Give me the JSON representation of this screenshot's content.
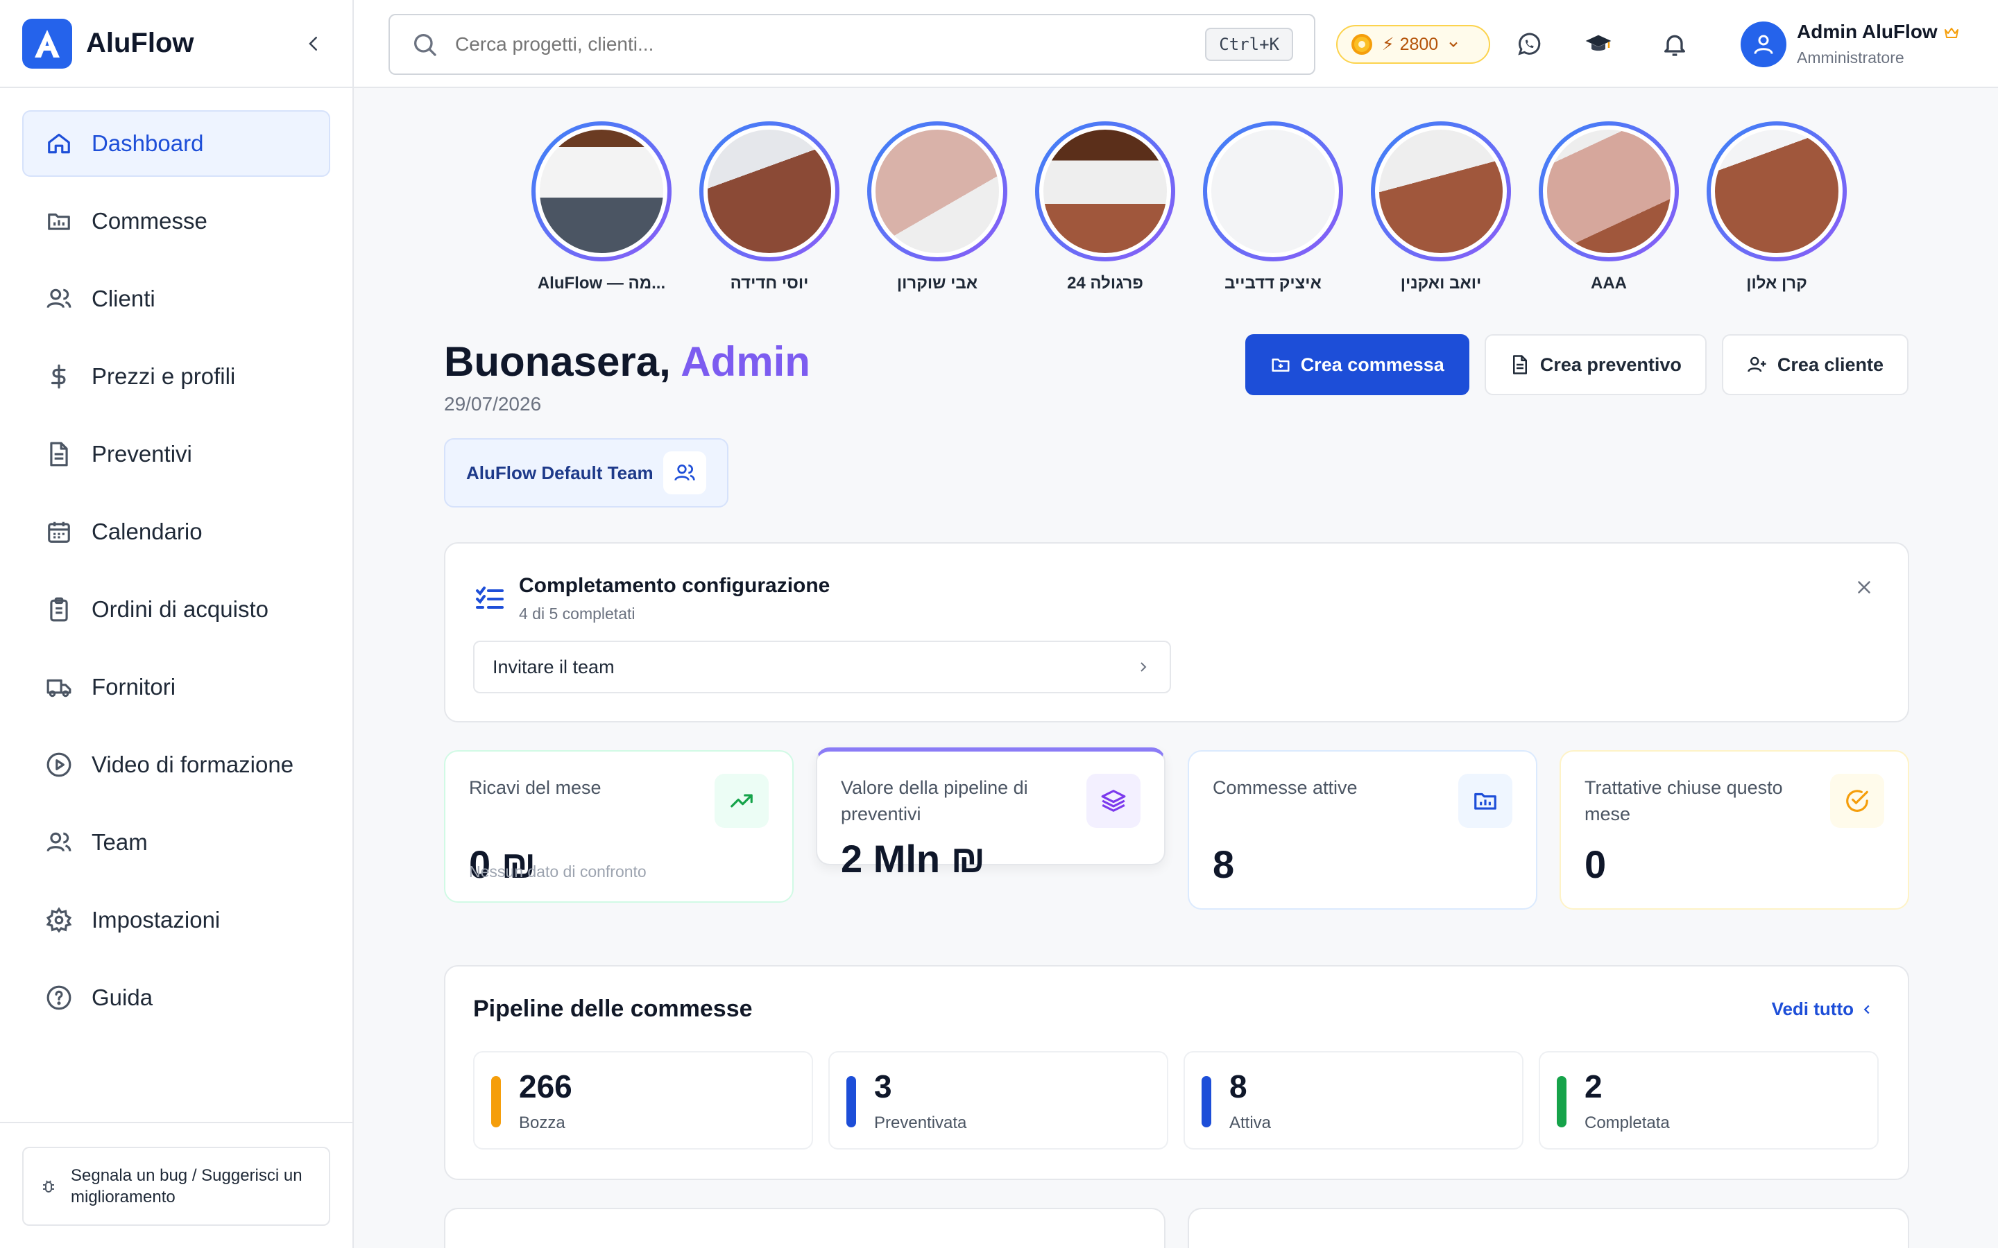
{
  "app": {
    "name": "AluFlow"
  },
  "sidebar": {
    "items": [
      {
        "label": "Dashboard",
        "icon": "home-icon",
        "active": true
      },
      {
        "label": "Commesse",
        "icon": "folder-icon"
      },
      {
        "label": "Clienti",
        "icon": "users-icon"
      },
      {
        "label": "Prezzi e profili",
        "icon": "dollar-icon"
      },
      {
        "label": "Preventivi",
        "icon": "file-text-icon"
      },
      {
        "label": "Calendario",
        "icon": "calendar-icon"
      },
      {
        "label": "Ordini di acquisto",
        "icon": "clipboard-icon"
      },
      {
        "label": "Fornitori",
        "icon": "truck-icon"
      },
      {
        "label": "Video di formazione",
        "icon": "play-circle-icon"
      },
      {
        "label": "Team",
        "icon": "team-icon"
      },
      {
        "label": "Impostazioni",
        "icon": "gear-icon"
      },
      {
        "label": "Guida",
        "icon": "help-circle-icon"
      }
    ],
    "bug_report": "Segnala un bug / Suggerisci un miglioramento"
  },
  "topbar": {
    "search_placeholder": "Cerca progetti, clienti...",
    "shortcut": "Ctrl+K",
    "credits": "2800",
    "user_name": "Admin AluFlow",
    "user_role": "Amministratore"
  },
  "stories": [
    {
      "label": "AluFlow — מה..."
    },
    {
      "label": "יוסי חדידה"
    },
    {
      "label": "אבי שוקרון"
    },
    {
      "label": "פרגולה 24"
    },
    {
      "label": "איציק דדבייב"
    },
    {
      "label": "יואב ואקנין"
    },
    {
      "label": "AAA"
    },
    {
      "label": "קרן אלון"
    }
  ],
  "greeting": {
    "prefix": "Buonasera, ",
    "name": "Admin",
    "date": "29/07/2026"
  },
  "team_chip": "AluFlow Default Team",
  "actions": {
    "create_job": "Crea commessa",
    "create_quote": "Crea preventivo",
    "create_client": "Crea cliente"
  },
  "setup": {
    "title": "Completamento configurazione",
    "progress": "4 di 5 completati",
    "step": "Invitare il team"
  },
  "stats": [
    {
      "label": "Ricavi del mese",
      "value": "0 ₪",
      "foot": "Nessun dato di confronto",
      "icon": "trending-up-icon"
    },
    {
      "label": "Valore della pipeline di preventivi",
      "value": "2 Mln ₪",
      "icon": "layers-icon"
    },
    {
      "label": "Commesse attive",
      "value": "8",
      "icon": "folder-chart-icon"
    },
    {
      "label": "Trattative chiuse questo mese",
      "value": "0",
      "icon": "check-circle-icon"
    }
  ],
  "pipeline": {
    "title": "Pipeline delle commesse",
    "link": "Vedi tutto",
    "stages": [
      {
        "count": "266",
        "label": "Bozza",
        "color": "#f59e0b"
      },
      {
        "count": "3",
        "label": "Preventivata",
        "color": "#1d4ed8"
      },
      {
        "count": "8",
        "label": "Attiva",
        "color": "#1d4ed8"
      },
      {
        "count": "2",
        "label": "Completata",
        "color": "#16a34a"
      }
    ]
  },
  "colors": {
    "primary": "#1d4ed8",
    "accent": "#7c5cf0"
  }
}
